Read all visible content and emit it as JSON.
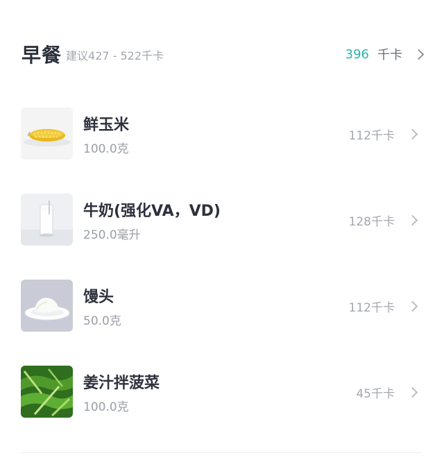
{
  "meal": {
    "title": "早餐",
    "suggestion": "建议427 - 522千卡",
    "total_kcal": "396",
    "kcal_unit": "千卡"
  },
  "foods": [
    {
      "name": "鲜玉米",
      "amount": "100.0克",
      "kcal": "112千卡",
      "thumb_icon": "corn-photo"
    },
    {
      "name": "牛奶(强化VA，VD)",
      "amount": "250.0毫升",
      "kcal": "128千卡",
      "thumb_icon": "milk-glass-photo"
    },
    {
      "name": "馒头",
      "amount": "50.0克",
      "kcal": "112千卡",
      "thumb_icon": "steamed-bun-photo"
    },
    {
      "name": "姜汁拌菠菜",
      "amount": "100.0克",
      "kcal": "45千卡",
      "thumb_icon": "spinach-photo"
    }
  ],
  "colors": {
    "accent": "#26b5ae",
    "title": "#2c313c",
    "secondary": "#a3a7ad"
  }
}
